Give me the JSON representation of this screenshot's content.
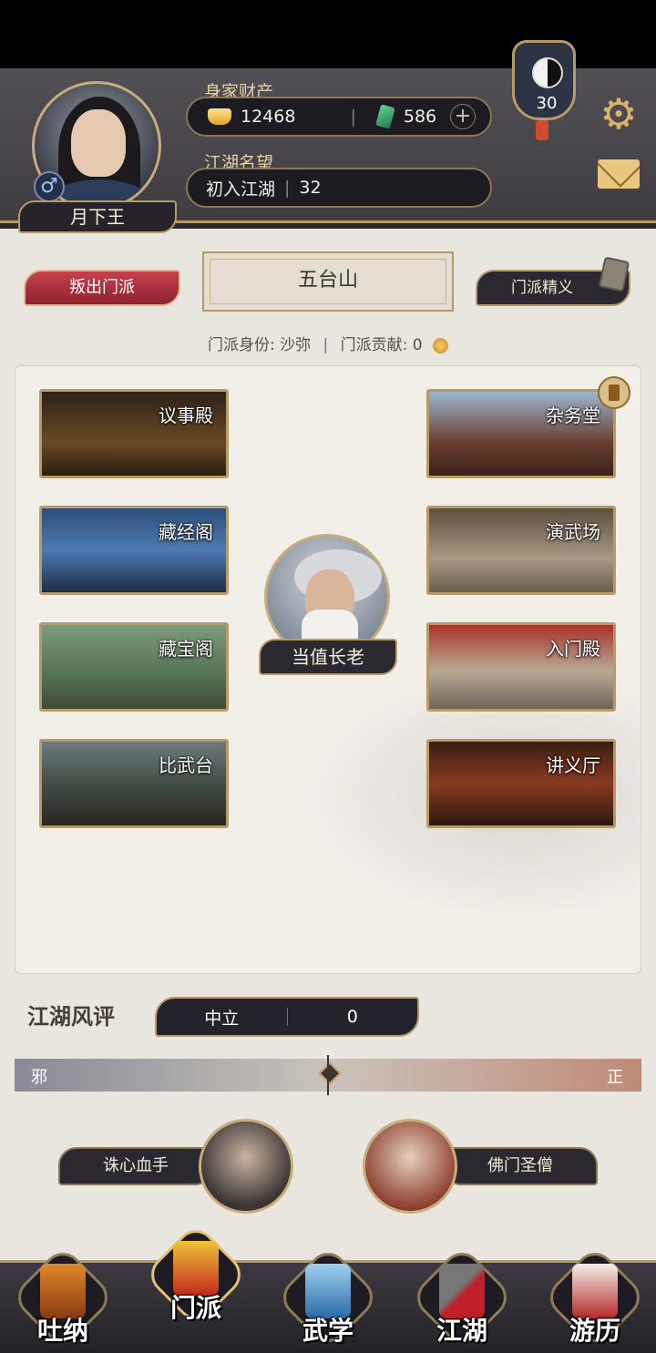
{
  "header": {
    "player_name": "月下王",
    "gender_symbol": "♂",
    "wealth_label": "身家财产",
    "gold": "12468",
    "jade": "586",
    "plus_symbol": "+",
    "reputation_label": "江湖名望",
    "reputation_title": "初入江湖",
    "reputation_value": "32",
    "level": "30",
    "gear_glyph": "⚙"
  },
  "sect": {
    "betray_label": "叛出门派",
    "name": "五台山",
    "essence_label": "门派精义",
    "identity_label": "门派身份:",
    "identity_value": "沙弥",
    "contribution_label": "门派贡献:",
    "contribution_value": "0"
  },
  "halls_left": [
    {
      "label": "议事殿"
    },
    {
      "label": "藏经阁"
    },
    {
      "label": "藏宝阁"
    },
    {
      "label": "比武台"
    }
  ],
  "halls_right": [
    {
      "label": "杂务堂"
    },
    {
      "label": "演武场"
    },
    {
      "label": "入门殿"
    },
    {
      "label": "讲义厅"
    }
  ],
  "elder_label": "当值长老",
  "reputation_panel": {
    "title": "江湖风评",
    "stance": "中立",
    "score": "0",
    "evil_label": "邪",
    "good_label": "正",
    "stance_fraction": 0.5
  },
  "npcs": {
    "left_name": "诛心血手",
    "right_name": "佛门圣僧"
  },
  "nav": [
    {
      "label": "吐纳"
    },
    {
      "label": "门派"
    },
    {
      "label": "武学"
    },
    {
      "label": "江湖"
    },
    {
      "label": "游历"
    }
  ],
  "colors": {
    "accent_gold": "#b69a67",
    "betray_red": "#b5303f",
    "panel_dark": "#2b2830"
  }
}
